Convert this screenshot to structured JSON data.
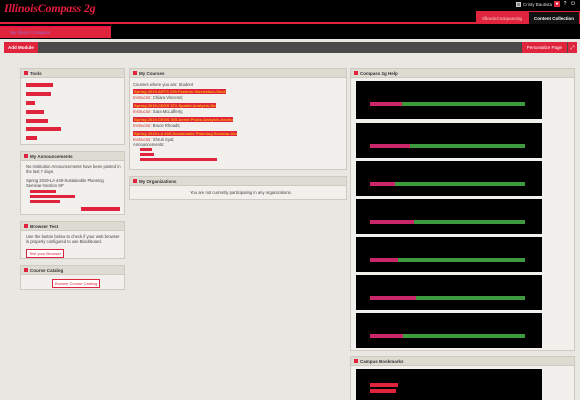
{
  "header": {
    "logo": "IllinoisCompass 2g",
    "user_name": "Cristy Bautista",
    "tabs": [
      {
        "label": "IllinoisCompass2g",
        "active": true
      },
      {
        "label": "Content Collection",
        "active": false
      }
    ]
  },
  "page_tab": {
    "label": "My Illinois Compass"
  },
  "actions": {
    "add_module": "Add Module",
    "personalize": "Personalize Page"
  },
  "tools": {
    "title": "Tools"
  },
  "announcements": {
    "title": "My Announcements",
    "note": "No Institution Announcements have been posted in the last 7 days.",
    "course": "Spring 2019-LA 449-Sustainable Planning Seminar-Section SP"
  },
  "browser_test": {
    "title": "Browser Test",
    "text": "Use the button below to check if your web browser is properly configured to use Blackboard.",
    "button": "Test your Browser"
  },
  "catalog": {
    "title": "Course Catalog",
    "button": "Browse Course Catalog"
  },
  "courses": {
    "title": "My Courses",
    "intro": "Courses where you are: Student",
    "items": [
      {
        "name": "Spring 2019-ARTS 299-Fashion Illustration-Section A25",
        "instructor_label": "Instructor:",
        "instructor": "Chiara Vincenzi;"
      },
      {
        "name": "Spring 2019-CEGS 371-Spatial Analysis-Section A",
        "instructor_label": "Instructor:",
        "instructor": "Sara McLafferty;"
      },
      {
        "name": "Spring 2019-CEGS 305-Aerial Photo Analysis-Section A3, A4",
        "instructor_label": "Instructor:",
        "instructor": "Bruce Rhoads;"
      },
      {
        "name": "Spring 2019-LA 449-Sustainable Planning Seminar-Section SP",
        "instructor_label": "Instructor:",
        "instructor": "Shruti Syal;",
        "extra": "Announcements:"
      }
    ]
  },
  "organizations": {
    "title": "My Organizations",
    "empty": "You are not currently participating in any organizations."
  },
  "help": {
    "title": "Compass 2g Help"
  },
  "bookmarks": {
    "title": "Campus Bookmarks"
  }
}
